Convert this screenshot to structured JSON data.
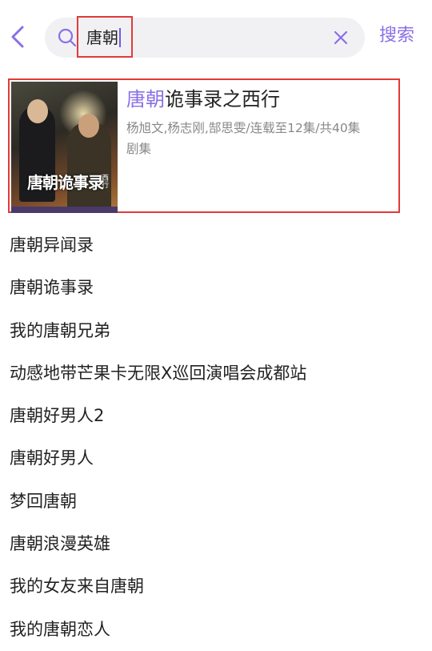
{
  "status_bar": {
    "left_partial": "",
    "right_partial": ""
  },
  "search": {
    "query": "唐朝",
    "search_button_label": "搜索"
  },
  "result": {
    "title_highlight": "唐朝",
    "title_rest": "诡事录之西行",
    "meta": "杨旭文,杨志刚,郜思雯/连载至12集/共40集",
    "type": "剧集",
    "poster_text": "唐朝诡事录",
    "poster_subtext": "西行"
  },
  "suggestions": [
    "唐朝异闻录",
    "唐朝诡事录",
    "我的唐朝兄弟",
    "动感地带芒果卡无限X巡回演唱会成都站",
    "唐朝好男人2",
    "唐朝好男人",
    "梦回唐朝",
    "唐朝浪漫英雄",
    "我的女友来自唐朝",
    "我的唐朝恋人"
  ],
  "colors": {
    "accent": "#8a6fe6",
    "highlight_box": "#e23a3a",
    "search_bg": "#f1f1f4"
  },
  "icons": {
    "back": "chevron-left-icon",
    "search": "search-icon",
    "clear": "close-icon"
  }
}
